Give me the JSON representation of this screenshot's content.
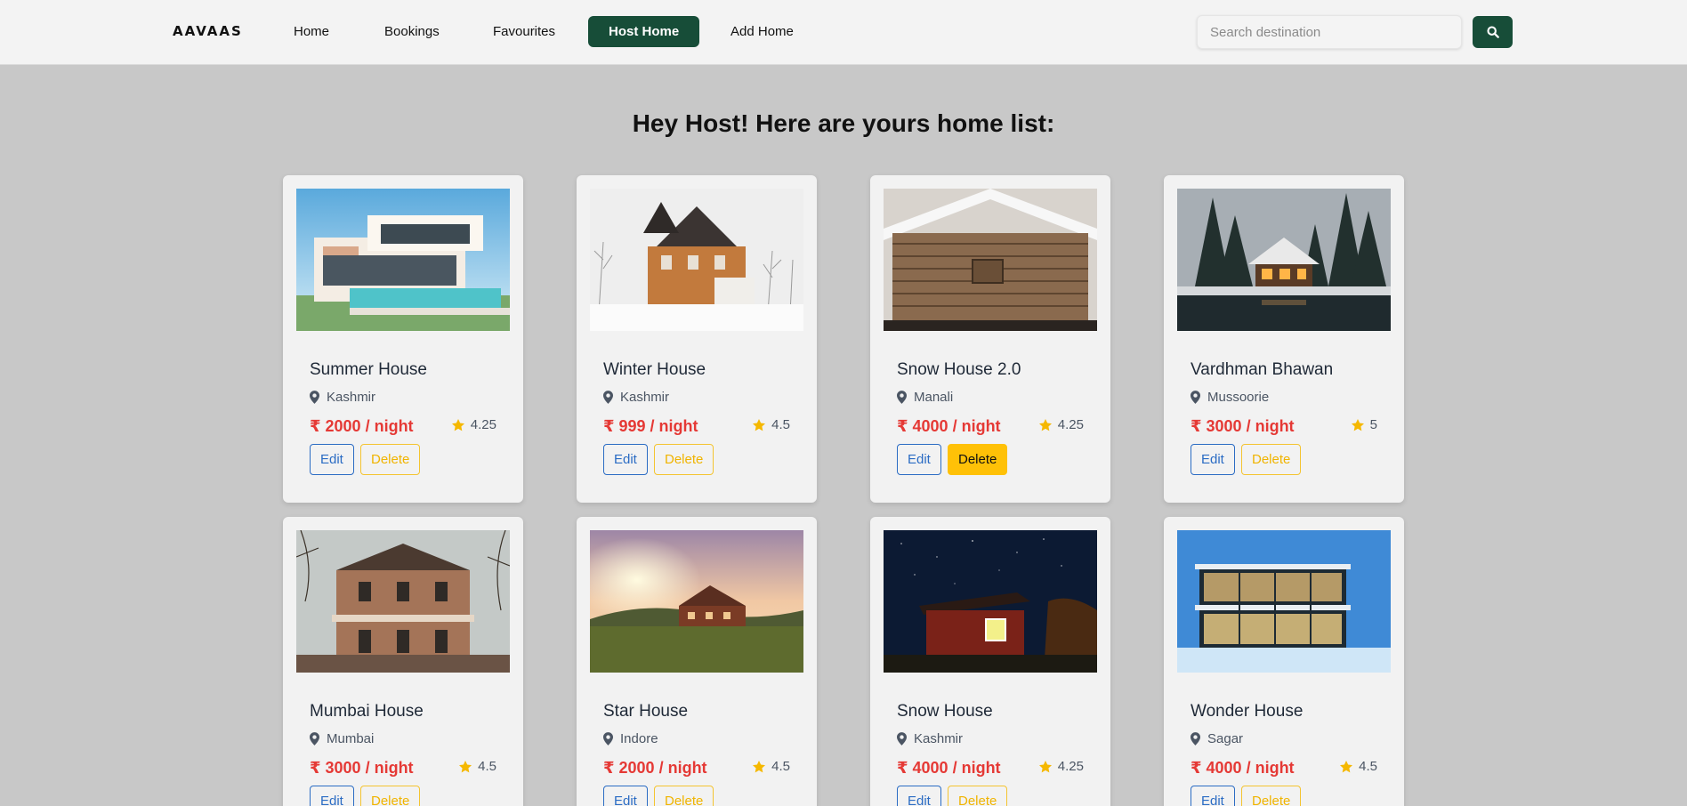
{
  "brand": "AAVAAS",
  "nav": {
    "items": [
      {
        "label": "Home"
      },
      {
        "label": "Bookings"
      },
      {
        "label": "Favourites"
      },
      {
        "label": "Host Home",
        "active": true
      },
      {
        "label": "Add Home"
      }
    ]
  },
  "search": {
    "placeholder": "Search destination",
    "value": ""
  },
  "page": {
    "title": "Hey Host! Here are yours home list:"
  },
  "actions": {
    "edit_label": "Edit",
    "delete_label": "Delete"
  },
  "homes": [
    {
      "name": "Summer House",
      "location": "Kashmir",
      "price": "₹ 2000 / night",
      "rating": "4.25"
    },
    {
      "name": "Winter House",
      "location": "Kashmir",
      "price": "₹ 999 / night",
      "rating": "4.5"
    },
    {
      "name": "Snow House 2.0",
      "location": "Manali",
      "price": "₹ 4000 / night",
      "rating": "4.25"
    },
    {
      "name": "Vardhman Bhawan",
      "location": "Mussoorie",
      "price": "₹ 3000 / night",
      "rating": "5"
    },
    {
      "name": "Mumbai House",
      "location": "Mumbai",
      "price": "₹ 3000 / night",
      "rating": "4.5"
    },
    {
      "name": "Star House",
      "location": "Indore",
      "price": "₹ 2000 / night",
      "rating": "4.5"
    },
    {
      "name": "Snow House",
      "location": "Kashmir",
      "price": "₹ 4000 / night",
      "rating": "4.25"
    },
    {
      "name": "Wonder House",
      "location": "Sagar",
      "price": "₹ 4000 / night",
      "rating": "4.5"
    }
  ],
  "colors": {
    "brand_green": "#174d38",
    "price_red": "#e53935",
    "edit_blue": "#2b6cc4",
    "delete_yellow": "#ffc107",
    "star_gold": "#f5b800",
    "page_bg": "#c8c8c8",
    "card_bg": "#f2f2f2"
  },
  "icons": {
    "location": "map-pin-icon",
    "rating": "star-icon",
    "search": "search-icon"
  }
}
